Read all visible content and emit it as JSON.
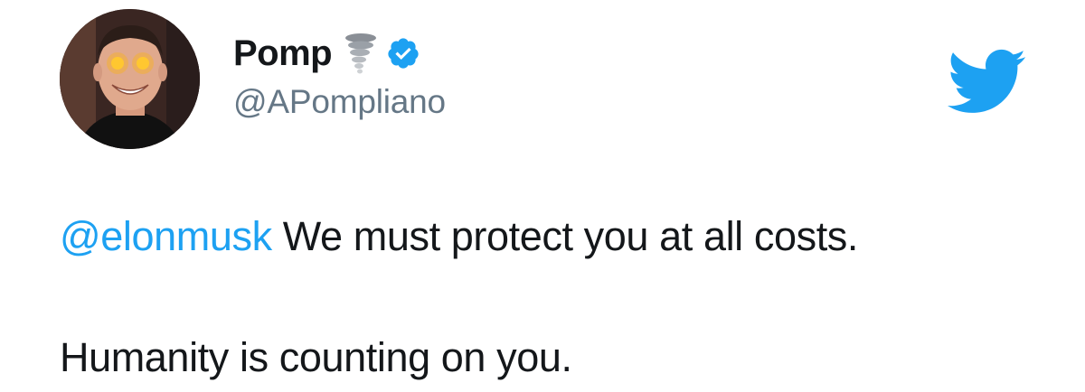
{
  "user": {
    "display_name": "Pomp",
    "handle": "@APompliano",
    "name_emoji": "tornado-icon",
    "verified_icon": "verified-badge-icon"
  },
  "brand": {
    "logo": "twitter-bird-icon",
    "accent_color": "#1da1f2"
  },
  "tweet": {
    "mention": "@elonmusk",
    "line1_text": "We must protect you at all costs.",
    "line2_text": "Humanity is counting on you."
  },
  "colors": {
    "text": "#14171a",
    "muted": "#657786",
    "link": "#1da1f2"
  }
}
